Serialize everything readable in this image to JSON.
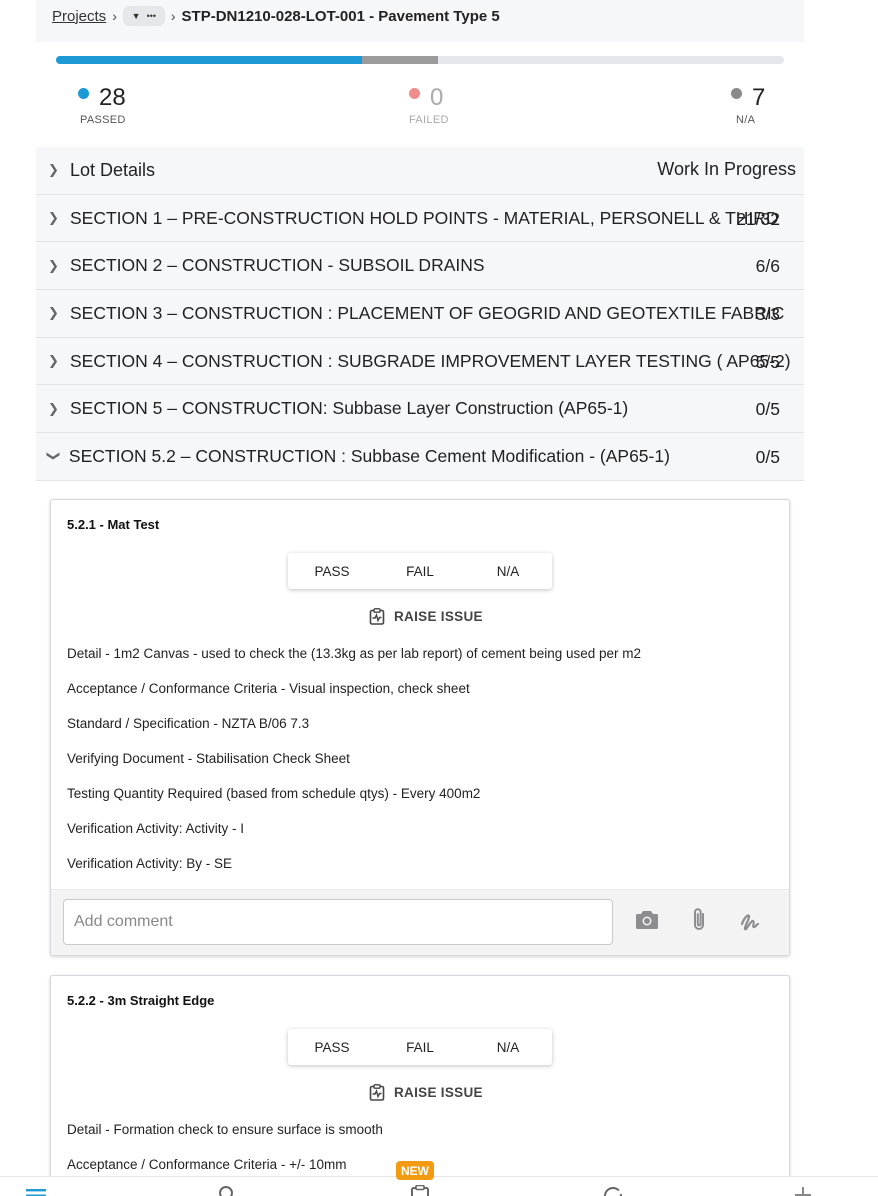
{
  "breadcrumb": {
    "root": "Projects",
    "more_glyph": "•••",
    "current": "STP-DN1210-028-LOT-001 - Pavement Type 5"
  },
  "progress": {
    "passed_fraction": 0.42,
    "na_fraction": 0.105
  },
  "stats": {
    "passed": {
      "value": "28",
      "label": "PASSED",
      "color": "#1b9ad6"
    },
    "failed": {
      "value": "0",
      "label": "FAILED",
      "color": "#f08c8c"
    },
    "na": {
      "value": "7",
      "label": "N/A",
      "color": "#8a8a8a"
    }
  },
  "lot": {
    "title": "Lot Details",
    "status": "Work In Progress"
  },
  "sections": [
    {
      "title": "SECTION 1 – PRE-CONSTRUCTION HOLD POINTS - MATERIAL, PERSONELL & THIRD",
      "count": "21/32",
      "expanded": false
    },
    {
      "title": "SECTION 2 – CONSTRUCTION - SUBSOIL DRAINS",
      "count": "6/6",
      "expanded": false
    },
    {
      "title": "SECTION 3 – CONSTRUCTION : PLACEMENT OF GEOGRID AND GEOTEXTILE FABRIC",
      "count": "3/3",
      "expanded": false
    },
    {
      "title": "SECTION 4 – CONSTRUCTION : SUBGRADE IMPROVEMENT LAYER TESTING ( AP65-2)",
      "count": "5/5",
      "expanded": false
    },
    {
      "title": "SECTION 5 – CONSTRUCTION: Subbase Layer Construction (AP65-1)",
      "count": "0/5",
      "expanded": false
    },
    {
      "title": "SECTION 5.2 – CONSTRUCTION : Subbase Cement Modification - (AP65-1)",
      "count": "0/5",
      "expanded": true
    }
  ],
  "buttons": {
    "pass": "PASS",
    "fail": "FAIL",
    "na": "N/A",
    "raise_issue": "RAISE ISSUE"
  },
  "items": [
    {
      "title": "5.2.1 - Mat Test",
      "details": [
        "Detail - 1m2 Canvas - used to check the (13.3kg as per lab report) of cement being used per m2",
        "Acceptance / Conformance Criteria - Visual inspection, check sheet",
        "Standard / Specification - NZTA B/06 7.3",
        "Verifying Document - Stabilisation Check Sheet",
        "Testing Quantity Required (based from schedule qtys) - Every 400m2",
        "Verification Activity: Activity - I",
        "Verification Activity: By - SE"
      ],
      "comment_placeholder": "Add comment"
    },
    {
      "title": "5.2.2 - 3m Straight Edge",
      "details": [
        "Detail - Formation check to ensure surface is smooth",
        "Acceptance / Conformance Criteria - +/- 10mm"
      ]
    }
  ],
  "badge": {
    "new": "NEW",
    "color": "#f29b10"
  }
}
